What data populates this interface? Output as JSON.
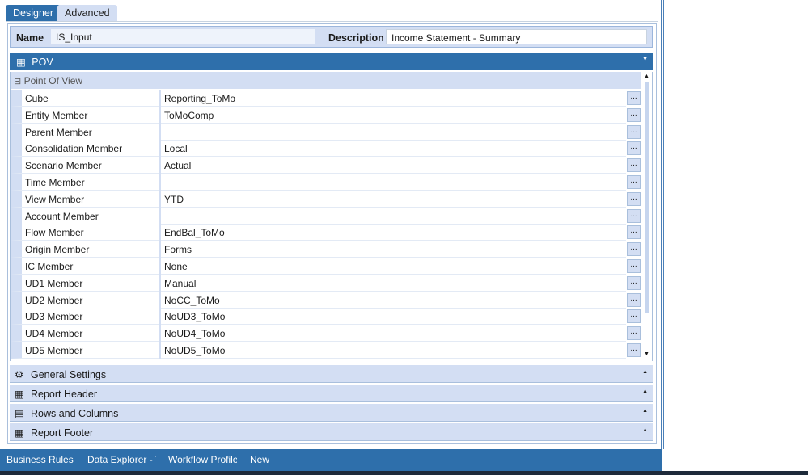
{
  "tabs": [
    {
      "label": "Designer",
      "active": true
    },
    {
      "label": "Advanced",
      "active": false
    }
  ],
  "name_label": "Name",
  "name_value": "IS_Input",
  "description_label": "Description",
  "description_value": "Income Statement - Summary",
  "pov_title": "POV",
  "category": "Point Of View",
  "button_label": "...",
  "rows": [
    {
      "label": "Cube",
      "value": "Reporting_ToMo"
    },
    {
      "label": "Entity Member",
      "value": "ToMoComp"
    },
    {
      "label": "Parent Member",
      "value": ""
    },
    {
      "label": "Consolidation Member",
      "value": "Local"
    },
    {
      "label": "Scenario Member",
      "value": "Actual"
    },
    {
      "label": "Time Member",
      "value": ""
    },
    {
      "label": "View Member",
      "value": "YTD"
    },
    {
      "label": "Account Member",
      "value": ""
    },
    {
      "label": "Flow Member",
      "value": "EndBal_ToMo"
    },
    {
      "label": "Origin Member",
      "value": "Forms"
    },
    {
      "label": "IC Member",
      "value": "None"
    },
    {
      "label": "UD1 Member",
      "value": "Manual"
    },
    {
      "label": "UD2 Member",
      "value": "NoCC_ToMo"
    },
    {
      "label": "UD3 Member",
      "value": "NoUD3_ToMo"
    },
    {
      "label": "UD4 Member",
      "value": "NoUD4_ToMo"
    },
    {
      "label": "UD5 Member",
      "value": "NoUD5_ToMo"
    }
  ],
  "sections": [
    {
      "label": "General Settings",
      "icon": "gear-icon"
    },
    {
      "label": "Report Header",
      "icon": "grid-icon"
    },
    {
      "label": "Rows and Columns",
      "icon": "rows-icon"
    },
    {
      "label": "Report Footer",
      "icon": "grid-icon"
    }
  ],
  "bottom_tabs": [
    "Business Rules",
    "Data Explorer - To",
    "Workflow Profiles",
    "New"
  ],
  "colors": {
    "accent": "#2e6fab",
    "light": "#d3def3"
  }
}
